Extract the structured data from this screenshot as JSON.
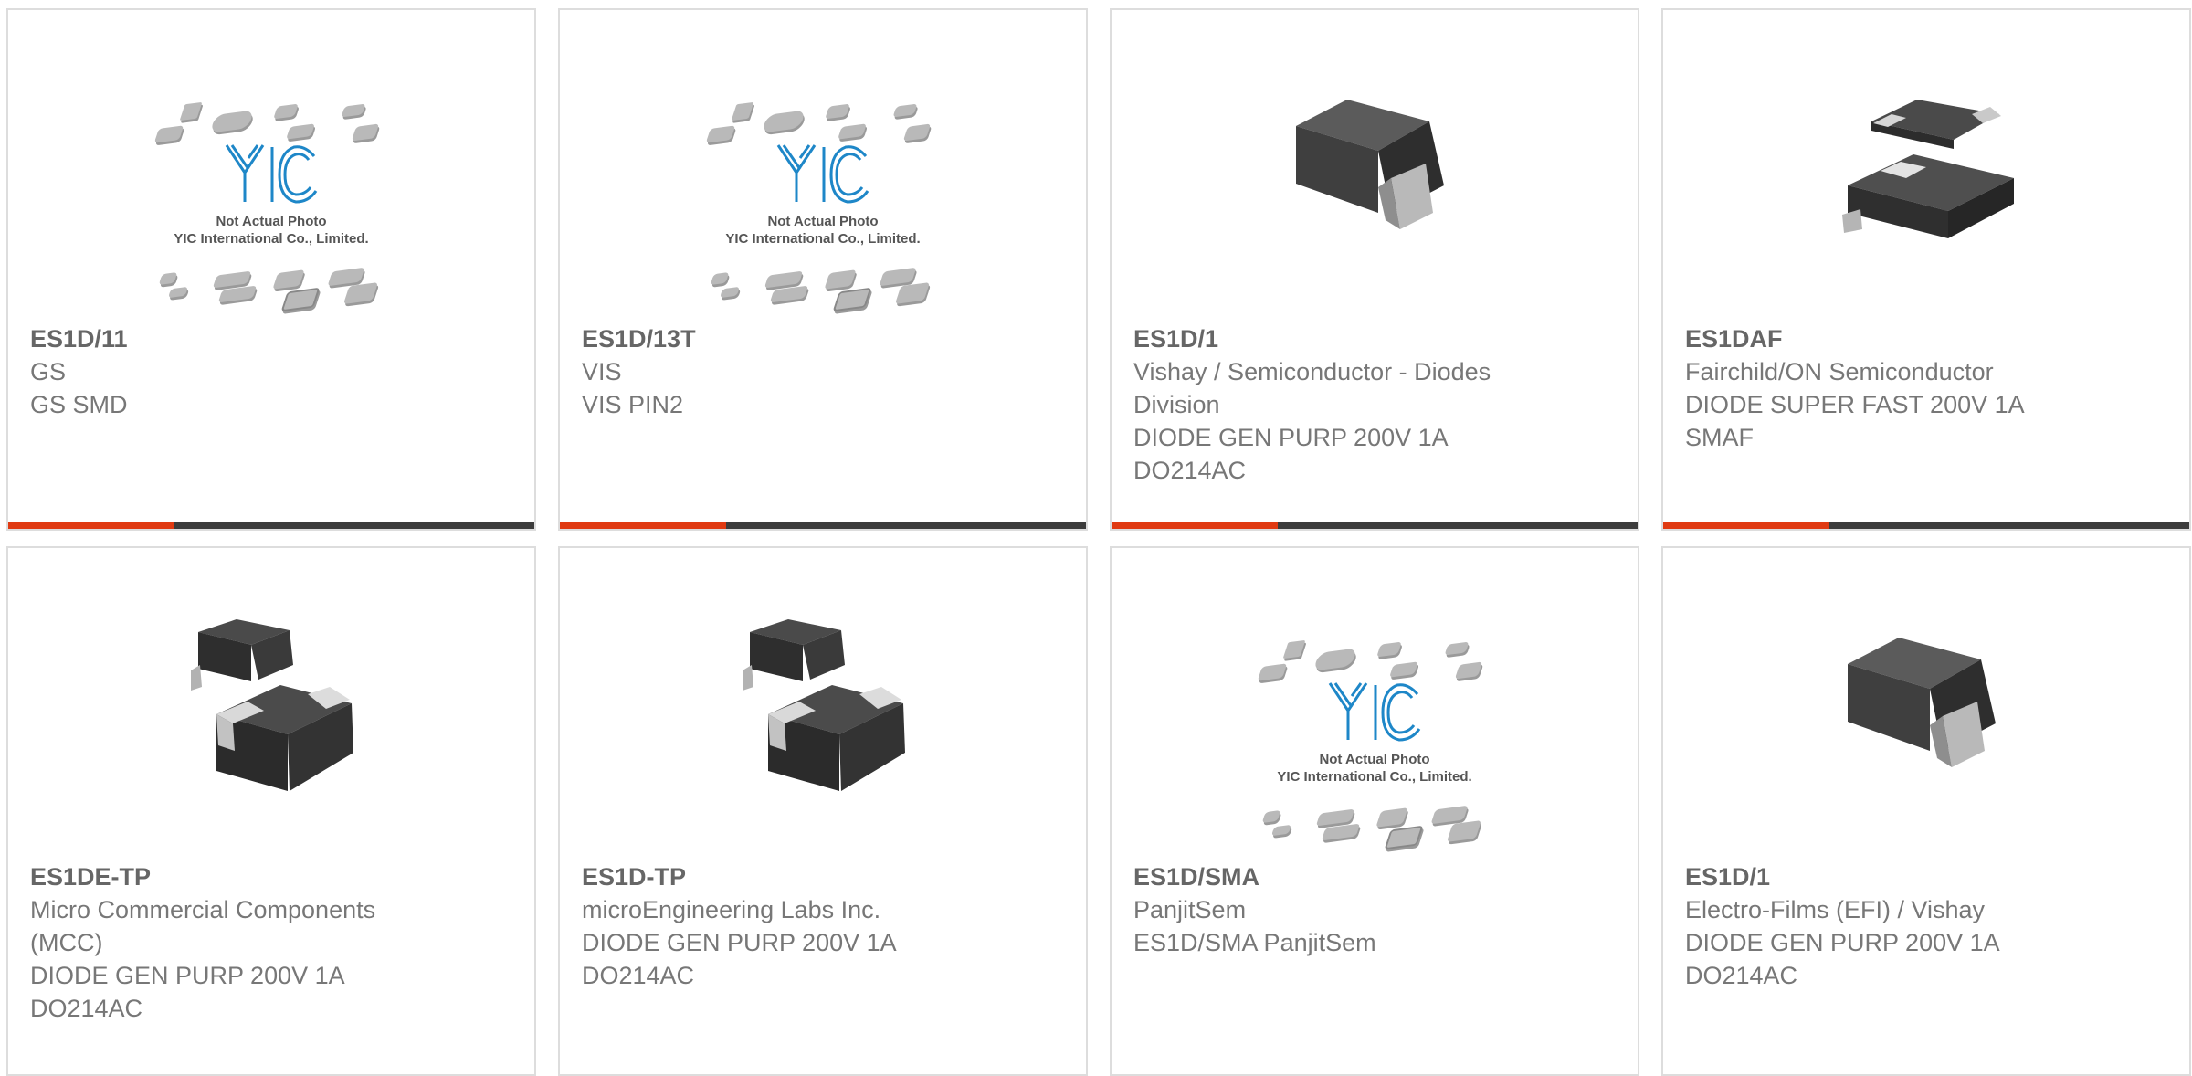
{
  "products": [
    {
      "part": "ES1D/11",
      "lines": [
        "GS",
        "GS SMD"
      ],
      "image": "placeholder"
    },
    {
      "part": "ES1D/13T",
      "lines": [
        "VIS",
        "VIS PIN2"
      ],
      "image": "placeholder"
    },
    {
      "part": "ES1D/1",
      "lines": [
        "Vishay / Semiconductor - Diodes",
        "Division",
        "DIODE GEN PURP 200V 1A",
        "DO214AC"
      ],
      "image": "do214ac"
    },
    {
      "part": "ES1DAF",
      "lines": [
        "Fairchild/ON Semiconductor",
        "DIODE SUPER FAST 200V 1A",
        "SMAF"
      ],
      "image": "smaf"
    },
    {
      "part": "ES1DE-TP",
      "lines": [
        "Micro Commercial Components",
        "(MCC)",
        "DIODE GEN PURP 200V 1A",
        "DO214AC"
      ],
      "image": "dual-do214ac"
    },
    {
      "part": "ES1D-TP",
      "lines": [
        "microEngineering Labs Inc.",
        "DIODE GEN PURP 200V 1A",
        "DO214AC"
      ],
      "image": "dual-do214ac"
    },
    {
      "part": "ES1D/SMA",
      "lines": [
        "PanjitSem",
        "ES1D/SMA PanjitSem"
      ],
      "image": "placeholder"
    },
    {
      "part": "ES1D/1",
      "lines": [
        "Electro-Films (EFI) / Vishay",
        "DIODE GEN PURP 200V 1A",
        "DO214AC"
      ],
      "image": "do214ac"
    }
  ],
  "placeholder": {
    "logo_text": "YIC",
    "caption_line1": "Not Actual Photo",
    "caption_line2": "YIC International Co., Limited."
  },
  "colors": {
    "accent": "#e03a12",
    "bar": "#3c3c3c",
    "text": "#777777"
  }
}
